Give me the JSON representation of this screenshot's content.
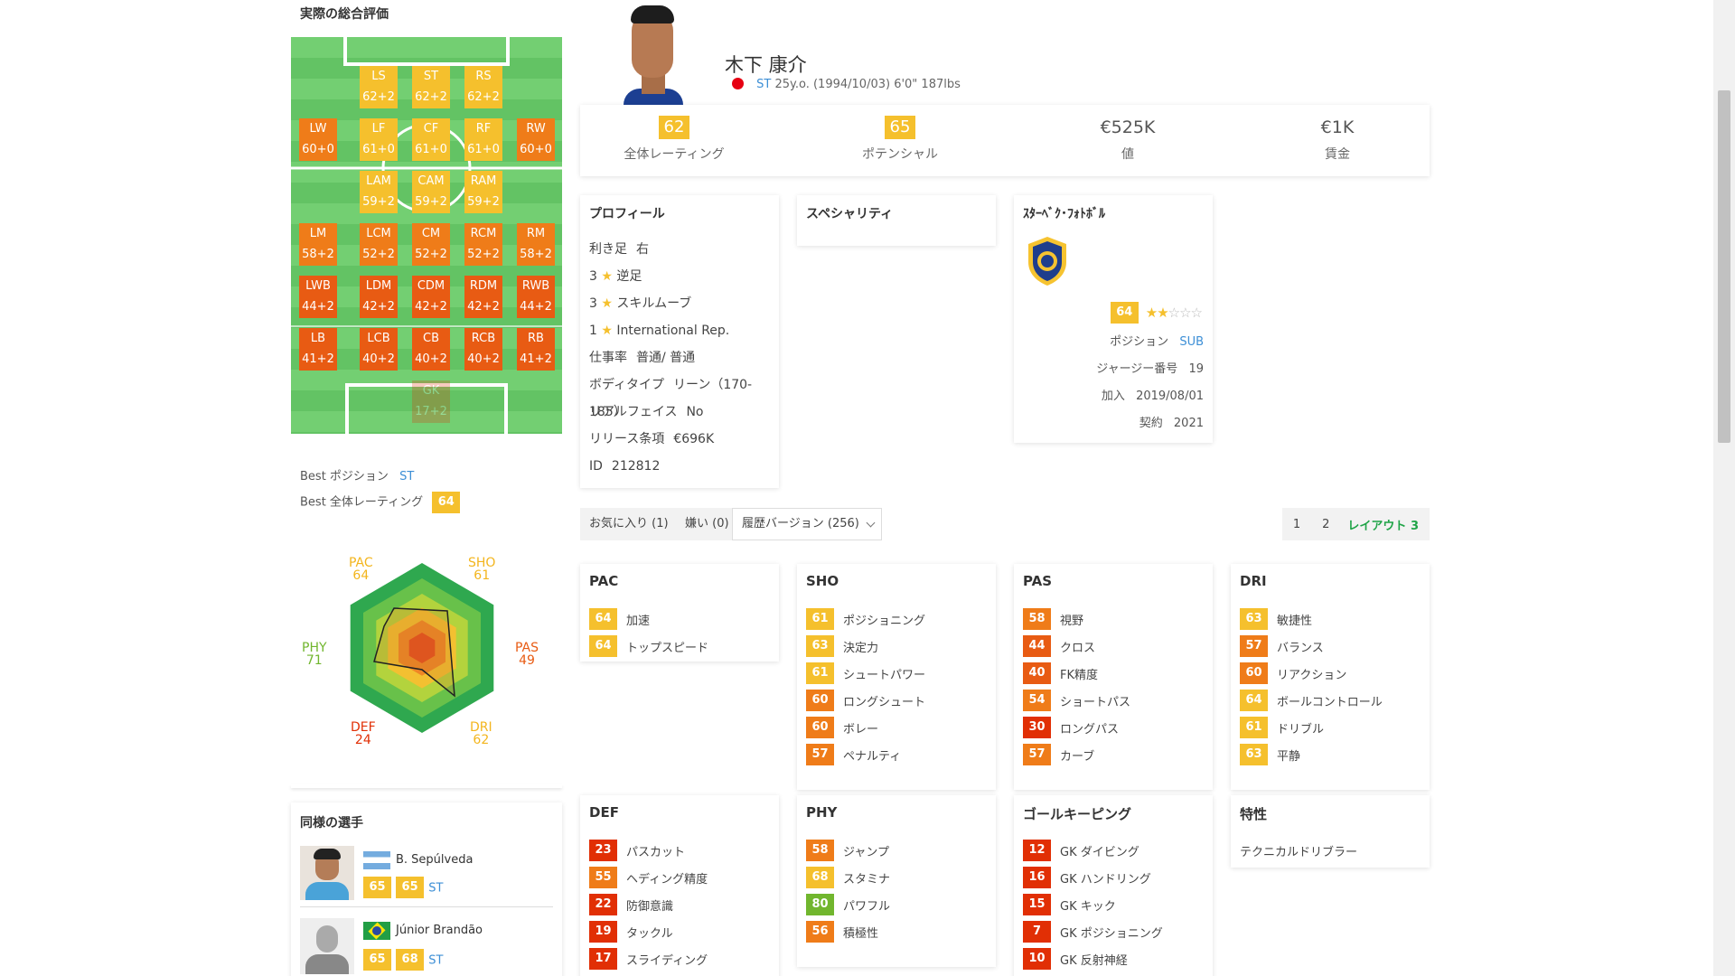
{
  "left": {
    "overall_title": "実際の総合評価",
    "positions": [
      {
        "id": "LS",
        "name": "LS",
        "val": "62+2",
        "c": "c-y"
      },
      {
        "id": "ST",
        "name": "ST",
        "val": "62+2",
        "c": "c-y"
      },
      {
        "id": "RS",
        "name": "RS",
        "val": "62+2",
        "c": "c-y"
      },
      {
        "id": "LW",
        "name": "LW",
        "val": "60+0",
        "c": "c-o"
      },
      {
        "id": "LF",
        "name": "LF",
        "val": "61+0",
        "c": "c-y"
      },
      {
        "id": "CF",
        "name": "CF",
        "val": "61+0",
        "c": "c-y"
      },
      {
        "id": "RF",
        "name": "RF",
        "val": "61+0",
        "c": "c-y"
      },
      {
        "id": "RW",
        "name": "RW",
        "val": "60+0",
        "c": "c-o"
      },
      {
        "id": "LAM",
        "name": "LAM",
        "val": "59+2",
        "c": "c-y"
      },
      {
        "id": "CAM",
        "name": "CAM",
        "val": "59+2",
        "c": "c-y"
      },
      {
        "id": "RAM",
        "name": "RAM",
        "val": "59+2",
        "c": "c-y"
      },
      {
        "id": "LM",
        "name": "LM",
        "val": "58+2",
        "c": "c-o"
      },
      {
        "id": "LCM",
        "name": "LCM",
        "val": "52+2",
        "c": "c-o"
      },
      {
        "id": "CM",
        "name": "CM",
        "val": "52+2",
        "c": "c-o"
      },
      {
        "id": "RCM",
        "name": "RCM",
        "val": "52+2",
        "c": "c-o"
      },
      {
        "id": "RM",
        "name": "RM",
        "val": "58+2",
        "c": "c-o"
      },
      {
        "id": "LWB",
        "name": "LWB",
        "val": "44+2",
        "c": "c-dor"
      },
      {
        "id": "LDM",
        "name": "LDM",
        "val": "42+2",
        "c": "c-dor"
      },
      {
        "id": "CDM",
        "name": "CDM",
        "val": "42+2",
        "c": "c-dor"
      },
      {
        "id": "RDM",
        "name": "RDM",
        "val": "42+2",
        "c": "c-dor"
      },
      {
        "id": "RWB",
        "name": "RWB",
        "val": "44+2",
        "c": "c-dor"
      },
      {
        "id": "LB",
        "name": "LB",
        "val": "41+2",
        "c": "c-dor"
      },
      {
        "id": "LCB",
        "name": "LCB",
        "val": "40+2",
        "c": "c-dor"
      },
      {
        "id": "CB",
        "name": "CB",
        "val": "40+2",
        "c": "c-dor"
      },
      {
        "id": "RCB",
        "name": "RCB",
        "val": "40+2",
        "c": "c-dor"
      },
      {
        "id": "RB",
        "name": "RB",
        "val": "41+2",
        "c": "c-dor"
      },
      {
        "id": "GK",
        "name": "GK",
        "val": "17+2",
        "c": "c-r"
      }
    ],
    "best_position_label": "Best ポジション",
    "best_position": "ST",
    "best_overall_label": "Best 全体レーティング",
    "best_overall": "64",
    "radar": {
      "PAC": {
        "label": "PAC",
        "value": "64"
      },
      "SHO": {
        "label": "SHO",
        "value": "61"
      },
      "PAS": {
        "label": "PAS",
        "value": "49"
      },
      "DRI": {
        "label": "DRI",
        "value": "62"
      },
      "DEF": {
        "label": "DEF",
        "value": "24"
      },
      "PHY": {
        "label": "PHY",
        "value": "71"
      }
    },
    "similar_title": "同様の選手",
    "similar": [
      {
        "name": "B. Sepúlveda",
        "ovr": "65",
        "pot": "65",
        "pos": "ST"
      },
      {
        "name": "Júnior Brandão",
        "ovr": "65",
        "pot": "68",
        "pos": "ST"
      }
    ]
  },
  "player": {
    "name": "木下 康介",
    "position": "ST",
    "info": "25y.o. (1994/10/03) 6'0\" 187lbs",
    "overall": "62",
    "overall_label": "全体レーティング",
    "potential": "65",
    "potential_label": "ポテンシャル",
    "value": "€525K",
    "value_label": "値",
    "wage": "€1K",
    "wage_label": "賃金"
  },
  "profile": {
    "title": "プロフィール",
    "rows": [
      {
        "label": "利き足",
        "value": "右"
      },
      {
        "label": "3",
        "value": "逆足",
        "star": true
      },
      {
        "label": "3",
        "value": "スキルムーブ",
        "star": true
      },
      {
        "label": "1",
        "value": "International Rep.",
        "star": true
      },
      {
        "label": "仕事率",
        "value": "普通/ 普通"
      },
      {
        "label": "ボディタイプ",
        "value": "リーン（170-185）"
      },
      {
        "label": "リアルフェイス",
        "value": "No"
      },
      {
        "label": "リリース条項",
        "value": "€696K"
      },
      {
        "label": "ID",
        "value": "212812"
      }
    ]
  },
  "specialities": {
    "title": "スペシャリティ"
  },
  "club": {
    "title": "ｽﾀｰﾍﾞｸ･ﾌｫﾄﾎﾞﾙ",
    "rating": "64",
    "position_label": "ポジション",
    "position": "SUB",
    "jersey_label": "ジャージー番号",
    "jersey": "19",
    "joined_label": "加入",
    "joined": "2019/08/01",
    "contract_label": "契約",
    "contract": "2021"
  },
  "toolbar": {
    "favorites": "お気に入り (1)",
    "dislikes": "嫌い (0)",
    "history": "履歴バージョン (256)",
    "layout1": "1",
    "layout2": "2",
    "layout3": "レイアウト 3"
  },
  "attributes": [
    {
      "title": "PAC",
      "items": [
        {
          "v": "64",
          "c": "c-y",
          "n": "加速"
        },
        {
          "v": "64",
          "c": "c-y",
          "n": "トップスピード"
        }
      ]
    },
    {
      "title": "SHO",
      "items": [
        {
          "v": "61",
          "c": "c-y",
          "n": "ポジショニング"
        },
        {
          "v": "63",
          "c": "c-y",
          "n": "決定力"
        },
        {
          "v": "61",
          "c": "c-y",
          "n": "シュートパワー"
        },
        {
          "v": "60",
          "c": "c-o",
          "n": "ロングシュート"
        },
        {
          "v": "60",
          "c": "c-o",
          "n": "ボレー"
        },
        {
          "v": "57",
          "c": "c-o",
          "n": "ペナルティ"
        }
      ]
    },
    {
      "title": "PAS",
      "items": [
        {
          "v": "58",
          "c": "c-o",
          "n": "視野"
        },
        {
          "v": "44",
          "c": "c-dor",
          "n": "クロス"
        },
        {
          "v": "40",
          "c": "c-dor",
          "n": "FK精度"
        },
        {
          "v": "54",
          "c": "c-o",
          "n": "ショートパス"
        },
        {
          "v": "30",
          "c": "c-r",
          "n": "ロングパス"
        },
        {
          "v": "57",
          "c": "c-o",
          "n": "カーブ"
        }
      ]
    },
    {
      "title": "DRI",
      "items": [
        {
          "v": "63",
          "c": "c-y",
          "n": "敏捷性"
        },
        {
          "v": "57",
          "c": "c-o",
          "n": "バランス"
        },
        {
          "v": "60",
          "c": "c-o",
          "n": "リアクション"
        },
        {
          "v": "64",
          "c": "c-y",
          "n": "ボールコントロール"
        },
        {
          "v": "61",
          "c": "c-y",
          "n": "ドリブル"
        },
        {
          "v": "63",
          "c": "c-y",
          "n": "平静"
        }
      ]
    },
    {
      "title": "DEF",
      "items": [
        {
          "v": "23",
          "c": "c-r",
          "n": "パスカット"
        },
        {
          "v": "55",
          "c": "c-o",
          "n": "ヘディング精度"
        },
        {
          "v": "22",
          "c": "c-r",
          "n": "防御意識"
        },
        {
          "v": "19",
          "c": "c-r",
          "n": "タックル"
        },
        {
          "v": "17",
          "c": "c-r",
          "n": "スライディング"
        }
      ]
    },
    {
      "title": "PHY",
      "items": [
        {
          "v": "58",
          "c": "c-o",
          "n": "ジャンプ"
        },
        {
          "v": "68",
          "c": "c-y",
          "n": "スタミナ"
        },
        {
          "v": "80",
          "c": "c-g",
          "n": "パワフル"
        },
        {
          "v": "56",
          "c": "c-o",
          "n": "積極性"
        }
      ]
    },
    {
      "title": "ゴールキーピング",
      "items": [
        {
          "v": "12",
          "c": "c-r",
          "n": "GK ダイビング"
        },
        {
          "v": "16",
          "c": "c-r",
          "n": "GK ハンドリング"
        },
        {
          "v": "15",
          "c": "c-r",
          "n": "GK キック"
        },
        {
          "v": "7",
          "c": "c-r",
          "n": "GK ポジショニング"
        },
        {
          "v": "10",
          "c": "c-r",
          "n": "GK 反射神経"
        }
      ]
    },
    {
      "title": "特性",
      "traits": [
        "テクニカルドリブラー"
      ]
    }
  ]
}
